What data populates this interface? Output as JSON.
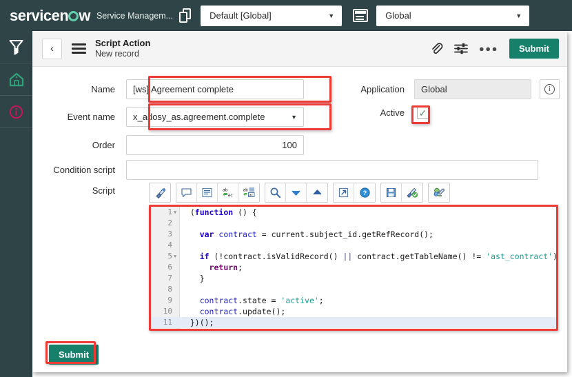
{
  "topbar": {
    "logo_text_1": "service",
    "logo_text_2": "n",
    "logo_text_3": "w",
    "app_name": "Service Managem...",
    "copy_icon": "copy-icon",
    "window_icon": "window-icon",
    "update_set": {
      "value": "Default [Global]",
      "caret": "▼"
    },
    "app_scope": {
      "value": "Global",
      "caret": "▼"
    }
  },
  "rail": {
    "items": [
      {
        "name": "filter-icon",
        "glyph": "filter"
      },
      {
        "name": "home-icon",
        "glyph": "home"
      },
      {
        "name": "info-icon",
        "glyph": "info"
      }
    ]
  },
  "form_header": {
    "back_label": "‹",
    "menu_icon": "hamburger-menu-icon",
    "title": "Script Action",
    "subtitle": "New record",
    "attachment_icon": "paperclip-icon",
    "personalize_icon": "sliders-icon",
    "more_label": "●●●",
    "submit_label": "Submit"
  },
  "form": {
    "name": {
      "label": "Name",
      "value": "[ws] Agreement complete"
    },
    "event_name": {
      "label": "Event name",
      "value": "x_adosy_as.agreement.complete",
      "caret": "▼"
    },
    "order": {
      "label": "Order",
      "value": "100"
    },
    "condition_script": {
      "label": "Condition script",
      "value": ""
    },
    "application": {
      "label": "Application",
      "value": "Global",
      "info_label": "i"
    },
    "active": {
      "label": "Active",
      "checked": true,
      "check_glyph": "✓"
    },
    "script": {
      "label": "Script"
    }
  },
  "script_toolbar": {
    "groups": [
      [
        {
          "name": "syntax-color-icon"
        }
      ],
      [
        {
          "name": "comment-icon"
        },
        {
          "name": "format-icon"
        },
        {
          "name": "replace-icon"
        },
        {
          "name": "replace-all-icon"
        }
      ],
      [
        {
          "name": "search-icon"
        },
        {
          "name": "find-next-icon"
        },
        {
          "name": "find-previous-icon"
        }
      ],
      [
        {
          "name": "open-new-window-icon"
        },
        {
          "name": "help-icon"
        }
      ],
      [
        {
          "name": "save-icon"
        },
        {
          "name": "syntax-check-icon"
        }
      ],
      [
        {
          "name": "code-snippet-icon"
        }
      ]
    ]
  },
  "editor": {
    "active_line": 11,
    "lines": [
      {
        "n": 1,
        "fold": true,
        "tokens": [
          {
            "t": "pln",
            "v": "  ("
          },
          {
            "t": "kw",
            "v": "function"
          },
          {
            "t": "pln",
            "v": " () {"
          }
        ]
      },
      {
        "n": 2,
        "fold": false,
        "tokens": []
      },
      {
        "n": 3,
        "fold": false,
        "tokens": [
          {
            "t": "pln",
            "v": "    "
          },
          {
            "t": "kw",
            "v": "var"
          },
          {
            "t": "pln",
            "v": " "
          },
          {
            "t": "id",
            "v": "contract"
          },
          {
            "t": "pln",
            "v": " = current.subject_id.getRefRecord();"
          }
        ]
      },
      {
        "n": 4,
        "fold": false,
        "tokens": []
      },
      {
        "n": 5,
        "fold": true,
        "tokens": [
          {
            "t": "pln",
            "v": "    "
          },
          {
            "t": "kw",
            "v": "if"
          },
          {
            "t": "pln",
            "v": " (!contract.isValidRecord() "
          },
          {
            "t": "op",
            "v": "||"
          },
          {
            "t": "pln",
            "v": " contract.getTableName() != "
          },
          {
            "t": "str",
            "v": "'ast_contract'"
          },
          {
            "t": "pln",
            "v": ") {"
          }
        ]
      },
      {
        "n": 6,
        "fold": false,
        "tokens": [
          {
            "t": "pln",
            "v": "      "
          },
          {
            "t": "kw2",
            "v": "return"
          },
          {
            "t": "pln",
            "v": ";"
          }
        ]
      },
      {
        "n": 7,
        "fold": false,
        "tokens": [
          {
            "t": "pln",
            "v": "    }"
          }
        ]
      },
      {
        "n": 8,
        "fold": false,
        "tokens": []
      },
      {
        "n": 9,
        "fold": false,
        "tokens": [
          {
            "t": "pln",
            "v": "    "
          },
          {
            "t": "id",
            "v": "contract"
          },
          {
            "t": "pln",
            "v": ".state = "
          },
          {
            "t": "str",
            "v": "'active'"
          },
          {
            "t": "pln",
            "v": ";"
          }
        ]
      },
      {
        "n": 10,
        "fold": false,
        "tokens": [
          {
            "t": "pln",
            "v": "    "
          },
          {
            "t": "id",
            "v": "contract"
          },
          {
            "t": "pln",
            "v": ".update();"
          }
        ]
      },
      {
        "n": 11,
        "fold": false,
        "tokens": [
          {
            "t": "pln",
            "v": "  })();"
          }
        ]
      }
    ]
  },
  "footer": {
    "submit_label": "Submit"
  },
  "colors": {
    "brand_dark": "#2e4447",
    "accent_teal": "#16806b",
    "annotation_red": "#ef3b36",
    "logo_green": "#62d0ae",
    "active_line": "#e4ecf7"
  }
}
